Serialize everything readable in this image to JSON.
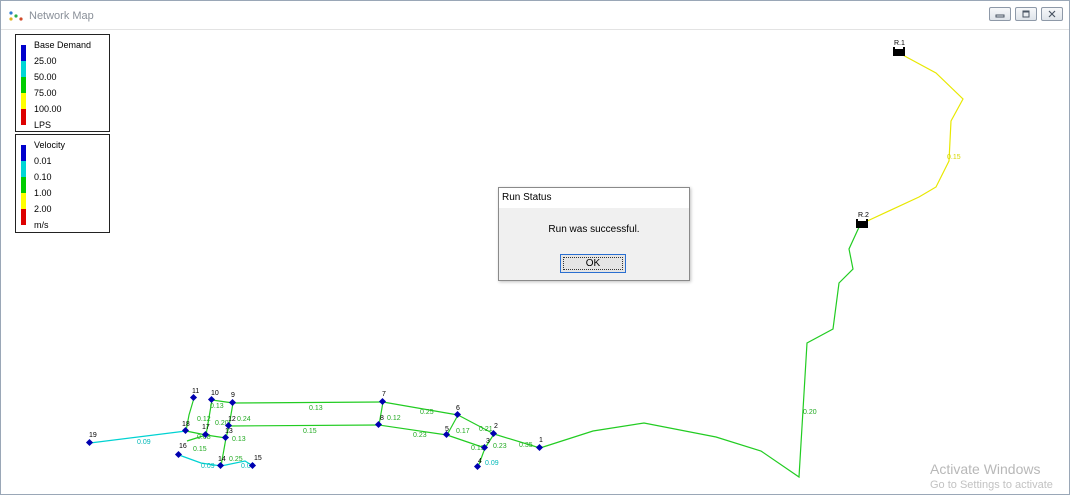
{
  "window": {
    "title": "Network Map",
    "controls": [
      "minimize-icon",
      "restore-icon",
      "close-icon"
    ]
  },
  "legend_demand": {
    "title": "Base Demand",
    "labels": [
      "25.00",
      "50.00",
      "75.00",
      "100.00"
    ],
    "unit": "LPS",
    "colors": [
      "#0000cc",
      "#00d5d5",
      "#00cc00",
      "#ffff00",
      "#dd0000"
    ]
  },
  "legend_velocity": {
    "title": "Velocity",
    "labels": [
      "0.01",
      "0.10",
      "1.00",
      "2.00"
    ],
    "unit": "m/s",
    "colors": [
      "#0000cc",
      "#00d5d5",
      "#00cc00",
      "#ffff00",
      "#dd0000"
    ]
  },
  "network": {
    "nodes": [
      "1",
      "2",
      "3",
      "4",
      "5",
      "6",
      "7",
      "8",
      "9",
      "10",
      "11",
      "12",
      "13",
      "14",
      "15",
      "16",
      "17",
      "18",
      "19"
    ],
    "reservoirs": [
      "R.1",
      "R.2"
    ],
    "link_labels": [
      "0.15",
      "0.20",
      "0.35",
      "0.23",
      "0.21",
      "0.19",
      "0.17",
      "0.23",
      "0.25",
      "0.12",
      "0.13",
      "0.15",
      "0.24",
      "0.13",
      "0.20",
      "0.12",
      "0.13",
      "0.15",
      "0.09",
      "0.25",
      "0.09",
      "0.05",
      "0.08",
      "0.09"
    ]
  },
  "dialog": {
    "title": "Run Status",
    "message": "Run was successful.",
    "ok_label": "OK"
  },
  "watermark": {
    "line1": "Activate Windows",
    "line2": "Go to Settings to activate"
  }
}
